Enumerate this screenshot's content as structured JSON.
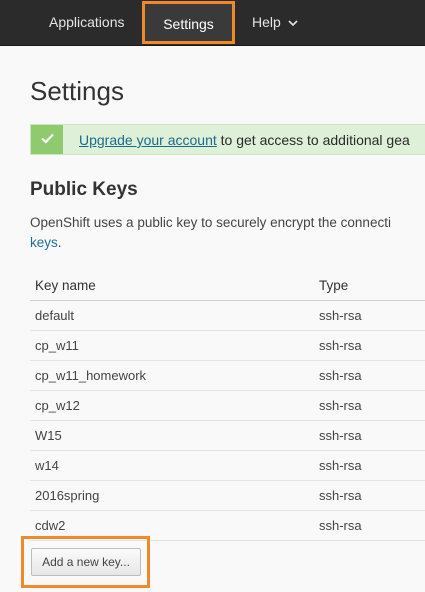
{
  "nav": {
    "applications": "Applications",
    "settings": "Settings",
    "help": "Help"
  },
  "page": {
    "title": "Settings"
  },
  "alert": {
    "link_text": "Upgrade your account",
    "text": " to get access to additional gea"
  },
  "public_keys": {
    "title": "Public Keys",
    "description": "OpenShift uses a public key to securely encrypt the connecti",
    "description_link": "keys",
    "columns": [
      "Key name",
      "Type"
    ],
    "rows": [
      {
        "name": "default",
        "type": "ssh-rsa"
      },
      {
        "name": "cp_w11",
        "type": "ssh-rsa"
      },
      {
        "name": "cp_w11_homework",
        "type": "ssh-rsa"
      },
      {
        "name": "cp_w12",
        "type": "ssh-rsa"
      },
      {
        "name": "W15",
        "type": "ssh-rsa"
      },
      {
        "name": "w14",
        "type": "ssh-rsa"
      },
      {
        "name": "2016spring",
        "type": "ssh-rsa"
      },
      {
        "name": "cdw2",
        "type": "ssh-rsa"
      }
    ],
    "add_button": "Add a new key..."
  },
  "colors": {
    "navbar": "#2b2b2b",
    "highlight": "#f0892a",
    "alert_bg": "#dff0d8",
    "alert_icon_bg": "#8fcb6e",
    "link": "#1f6f9a"
  },
  "icons": {
    "help_dropdown": "chevron-down-icon",
    "alert": "check-icon"
  }
}
